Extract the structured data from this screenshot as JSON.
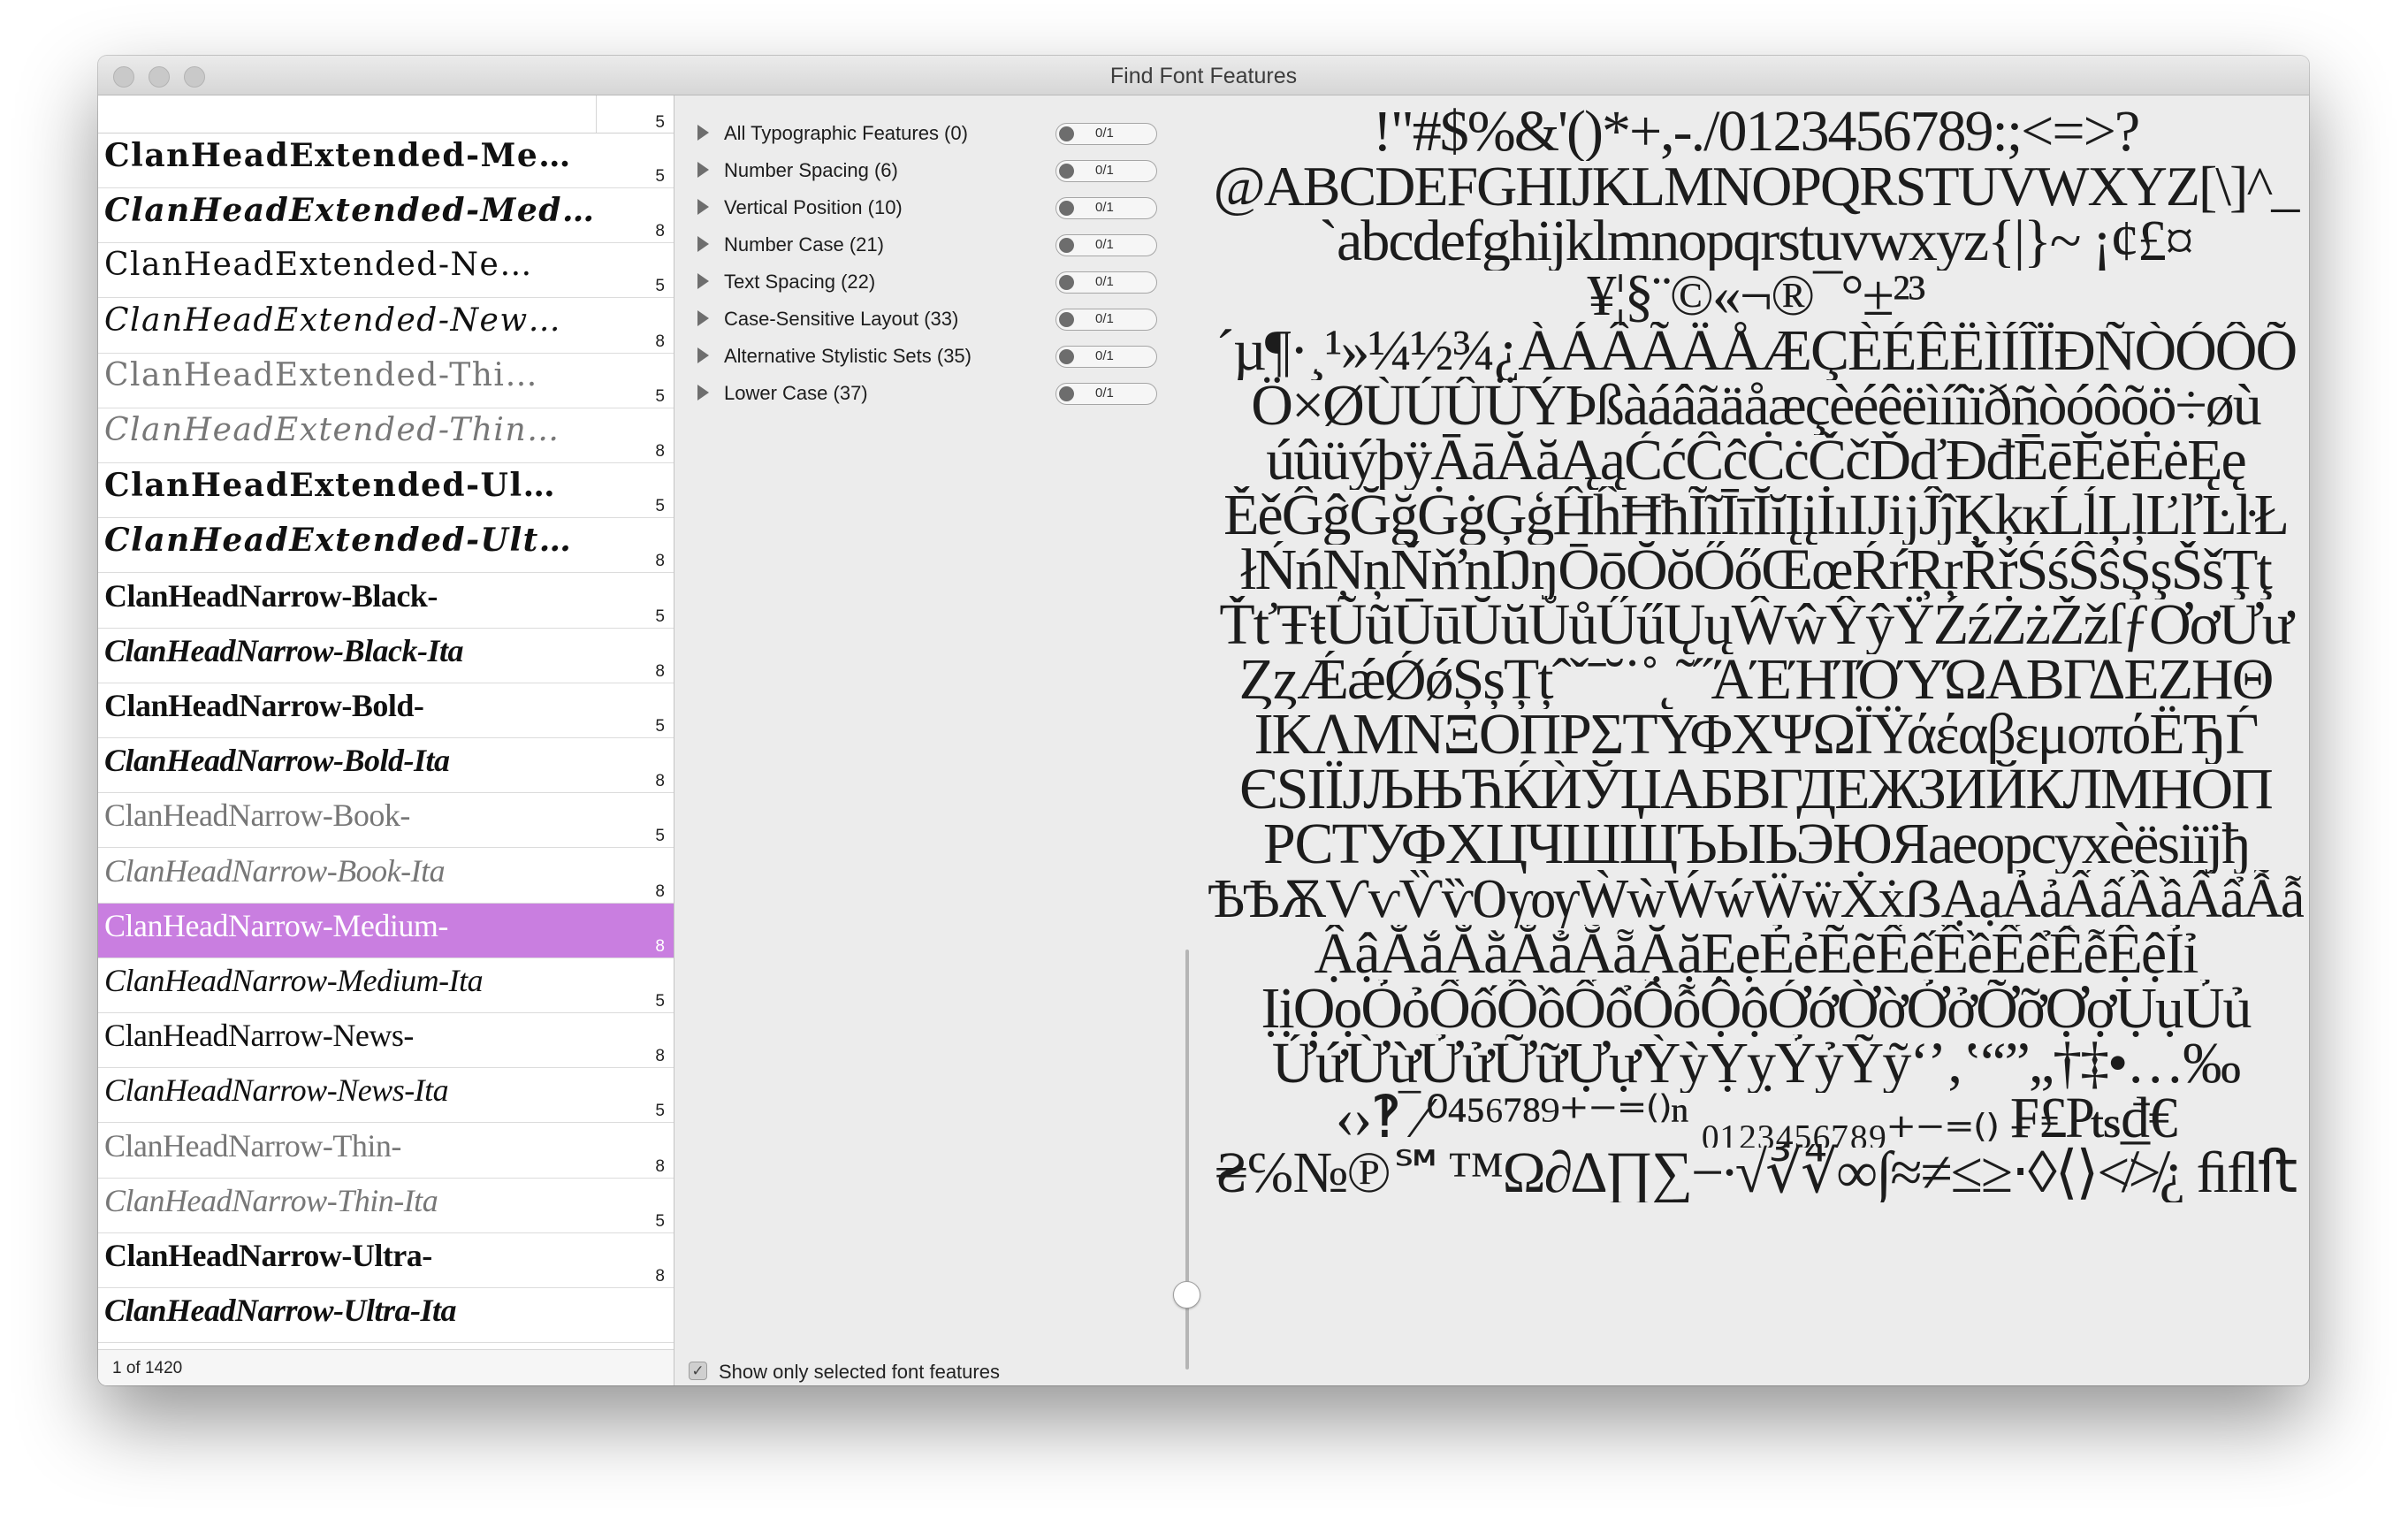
{
  "window": {
    "title": "Find Font Features"
  },
  "font_list": {
    "items": [
      {
        "name": "ClanHeadExtended-Me…",
        "count": "5",
        "style": "s-ext w-bold",
        "selected": false
      },
      {
        "name": "ClanHeadExtended-Med…",
        "count": "8",
        "style": "s-ext w-bold it",
        "selected": false
      },
      {
        "name": "ClanHeadExtended-Ne…",
        "count": "5",
        "style": "s-ext",
        "selected": false
      },
      {
        "name": "ClanHeadExtended-New…",
        "count": "8",
        "style": "s-ext it",
        "selected": false
      },
      {
        "name": "ClanHeadExtended-Thi…",
        "count": "5",
        "style": "s-ext w-thin",
        "selected": false
      },
      {
        "name": "ClanHeadExtended-Thin…",
        "count": "8",
        "style": "s-ext w-thin it",
        "selected": false
      },
      {
        "name": "ClanHeadExtended-Ul…",
        "count": "5",
        "style": "s-ext w-black",
        "selected": false
      },
      {
        "name": "ClanHeadExtended-Ult…",
        "count": "8",
        "style": "s-ext w-black it",
        "selected": false
      },
      {
        "name": "ClanHeadNarrow-Black-",
        "count": "5",
        "style": "s-nar w-black",
        "selected": false
      },
      {
        "name": "ClanHeadNarrow-Black-Ita",
        "count": "8",
        "style": "s-nar w-black it",
        "selected": false
      },
      {
        "name": "ClanHeadNarrow-Bold-",
        "count": "5",
        "style": "s-nar w-bold",
        "selected": false
      },
      {
        "name": "ClanHeadNarrow-Bold-Ita",
        "count": "8",
        "style": "s-nar w-bold it",
        "selected": false
      },
      {
        "name": "ClanHeadNarrow-Book-",
        "count": "5",
        "style": "s-nar w-thin",
        "selected": false
      },
      {
        "name": "ClanHeadNarrow-Book-Ita",
        "count": "8",
        "style": "s-nar w-thin it",
        "selected": false
      },
      {
        "name": "ClanHeadNarrow-Medium-",
        "count": "8",
        "style": "s-nar",
        "selected": true
      },
      {
        "name": "ClanHeadNarrow-Medium-Ita",
        "count": "5",
        "style": "s-nar it",
        "selected": false
      },
      {
        "name": "ClanHeadNarrow-News-",
        "count": "8",
        "style": "s-nar",
        "selected": false
      },
      {
        "name": "ClanHeadNarrow-News-Ita",
        "count": "5",
        "style": "s-nar it",
        "selected": false
      },
      {
        "name": "ClanHeadNarrow-Thin-",
        "count": "8",
        "style": "s-nar w-thin",
        "selected": false
      },
      {
        "name": "ClanHeadNarrow-Thin-Ita",
        "count": "5",
        "style": "s-nar w-thin it",
        "selected": false
      },
      {
        "name": "ClanHeadNarrow-Ultra-",
        "count": "8",
        "style": "s-nar w-black",
        "selected": false
      },
      {
        "name": "ClanHeadNarrow-Ultra-Ita",
        "count": "",
        "style": "s-nar w-black it",
        "selected": false
      }
    ],
    "first_count": "5",
    "status": "1 of 1420"
  },
  "features": [
    {
      "label": "All Typographic Features (0)",
      "toggle": "0/1"
    },
    {
      "label": "Number Spacing (6)",
      "toggle": "0/1"
    },
    {
      "label": "Vertical Position (10)",
      "toggle": "0/1"
    },
    {
      "label": "Number Case (21)",
      "toggle": "0/1"
    },
    {
      "label": "Text Spacing (22)",
      "toggle": "0/1"
    },
    {
      "label": "Case-Sensitive Layout (33)",
      "toggle": "0/1"
    },
    {
      "label": "Alternative Stylistic Sets (35)",
      "toggle": "0/1"
    },
    {
      "label": "Lower Case (37)",
      "toggle": "0/1"
    }
  ],
  "filter": {
    "show_only_selected_label": "Show only selected font features",
    "checked": true
  },
  "preview": {
    "lines": [
      "!\"#$%&'()*+,-./0123456789:;<=>?",
      "@ABCDEFGHIJKLMNOPQRSTUVWXYZ[\\]^_",
      "`abcdefghijklmnopqrstuvwxyz{|}~ ¡¢£¤",
      "¥¦§¨©«¬®¯°±²³",
      "´µ¶·¸¹»¼½¾¿ÀÁÂÃÄÅÆÇÈÉÊËÌÍÎÏÐÑÒÓÔÕ",
      "Ö×ØÙÚÛÜÝÞßàáâãäåæçèéêëìíîïðñòóôõö÷øù",
      "úûüýþÿĀāĂăĄąĆćĈĉĊċČčĎďĐđĒēĔĕĖėĘę",
      "ĚěĜĝĞğĠġĢģĤĥĦħĨĩĪīĬĭĮįİıĲĳĴĵĶķĸĹĺĻļĽľĿŀŁ",
      "łŃńŅņŇňŉŊŋŌōŎŏŐőŒœŔŕŖŗŘřŚśŜŝŞşŠšŢţ",
      "ŤťŦŧŨũŪūŬŭŮůŰűŲųŴŵŶŷŸŹźŻżŽžſƒƠơƯư",
      "ȤȥǼǽǾǿȘșȚțˆˇˉ˘˙˚˛˜˝ΆΈΉΊΌΎΏΑΒΓΔΕΖΗΘ",
      "ΙΚΛΜΝΞΟΠΡΣΤΥΦΧΨΩΪΫάέαβεμοπόЁЂЃ",
      "ЄЅІЇЈЉЊЋЌЍЎЏАБВГДЕЖЗИЙКЛМНОП",
      "РСТУФХЦЧШЩЪЫЬЭЮЯаеорсухѐёѕіїјђ",
      "ѢѢѪѴѵѶѷѸѹẀẁẂẃẄẅẊẋẞẠạẢảẤấẦầẨẩẪẫ",
      "ẬậẮắẰằẲẳẴẵẶặẸẹẺẻẼẽẾếỀềỂểỄễỆệỈỉ",
      "ỊịỌọỎỏỐốỒồỔổỖỗỘộỚớỜờỞởỠỡỢợỤụỦủ",
      "ỨứỪừỬửỮữỰựỲỳỴỵỶỷỸỹ‘’‚‛“”„†‡•…‰",
      "‹›‽‾⁄⁰⁴⁵⁶⁷⁸⁹⁺⁻⁼⁽⁾ⁿ ₀₁₂₃₄₅₆₇₈₉₊₋₌₍₎ ₣₤₧₫€",
      "₴℅№℗℠™Ω∂∆∏∑−∙√∛∜∞∫≈≠≤≥⋅◊⟨⟩≮≯¿ ﬁﬂﬅ"
    ]
  }
}
